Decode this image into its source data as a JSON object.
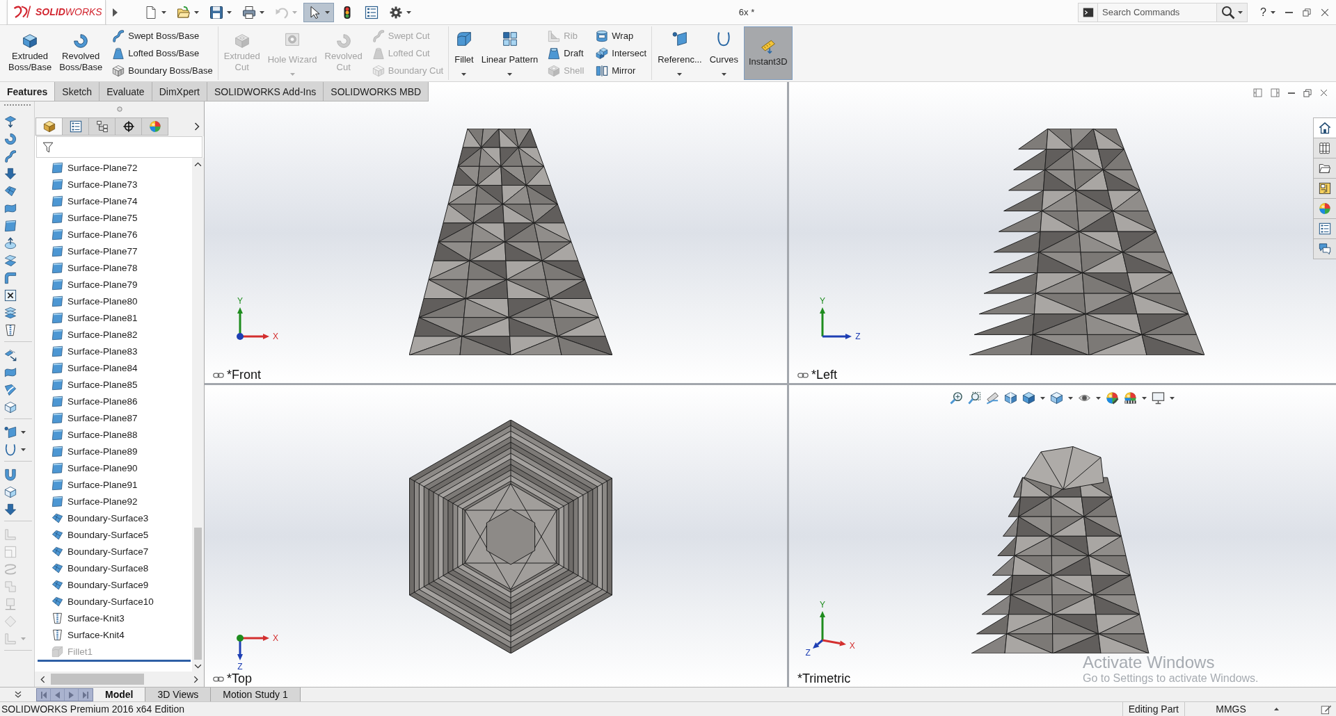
{
  "title_bar": {
    "logo": "**SOLID**WORKS",
    "document_title": "6x *",
    "search": {
      "placeholder": "Search Commands"
    },
    "help": "?"
  },
  "quick_access": [
    {
      "dropdown": true,
      "disabled": false,
      "selected": false
    },
    {
      "dropdown": true,
      "disabled": false,
      "selected": false
    },
    {
      "dropdown": true,
      "disabled": false,
      "selected": false
    },
    {
      "dropdown": true,
      "disabled": false,
      "selected": false
    },
    {
      "dropdown": true,
      "disabled": true,
      "selected": false
    },
    {
      "dropdown": true,
      "disabled": false,
      "selected": true
    },
    {
      "dropdown": false,
      "disabled": false,
      "selected": false
    },
    {
      "dropdown": false,
      "disabled": false,
      "selected": false
    },
    {
      "dropdown": true,
      "disabled": false,
      "selected": false
    }
  ],
  "ribbon": {
    "groups": [
      {
        "items": [
          {
            "kind": "large",
            "label": "Extruded Boss/Base",
            "disabled": false,
            "dropdown": false,
            "selected": false
          },
          {
            "kind": "large",
            "label": "Revolved Boss/Base",
            "disabled": false,
            "dropdown": false,
            "selected": false
          },
          {
            "kind": "stack",
            "tools": [
              {
                "label": "Swept Boss/Base",
                "disabled": false
              },
              {
                "label": "Lofted Boss/Base",
                "disabled": false
              },
              {
                "label": "Boundary Boss/Base",
                "disabled": false
              }
            ]
          }
        ]
      },
      {
        "items": [
          {
            "kind": "large",
            "label": "Extruded Cut",
            "disabled": true,
            "dropdown": false,
            "selected": false
          },
          {
            "kind": "large",
            "label": "Hole Wizard",
            "disabled": true,
            "dropdown": true,
            "selected": false
          },
          {
            "kind": "large",
            "label": "Revolved Cut",
            "disabled": true,
            "dropdown": false,
            "selected": false
          },
          {
            "kind": "stack",
            "tools": [
              {
                "label": "Swept Cut",
                "disabled": true
              },
              {
                "label": "Lofted Cut",
                "disabled": true
              },
              {
                "label": "Boundary Cut",
                "disabled": true
              }
            ]
          }
        ]
      },
      {
        "items": [
          {
            "kind": "large",
            "label": "Fillet",
            "disabled": false,
            "dropdown": true,
            "selected": false
          },
          {
            "kind": "large",
            "label": "Linear Pattern",
            "disabled": false,
            "dropdown": true,
            "selected": false
          },
          {
            "kind": "stack",
            "tools": [
              {
                "label": "Rib",
                "disabled": true
              },
              {
                "label": "Draft",
                "disabled": false
              },
              {
                "label": "Shell",
                "disabled": true
              }
            ]
          },
          {
            "kind": "stack",
            "tools": [
              {
                "label": "Wrap",
                "disabled": false
              },
              {
                "label": "Intersect",
                "disabled": false
              },
              {
                "label": "Mirror",
                "disabled": false
              }
            ]
          }
        ]
      },
      {
        "items": [
          {
            "kind": "large",
            "label": "Referenc...",
            "disabled": false,
            "dropdown": true,
            "selected": false
          },
          {
            "kind": "large",
            "label": "Curves",
            "disabled": false,
            "dropdown": true,
            "selected": false
          },
          {
            "kind": "large",
            "label": "Instant3D",
            "disabled": false,
            "dropdown": false,
            "selected": true
          }
        ]
      }
    ]
  },
  "command_tabs": [
    {
      "label": "Features",
      "selected": true
    },
    {
      "label": "Sketch",
      "selected": false
    },
    {
      "label": "Evaluate",
      "selected": false
    },
    {
      "label": "DimXpert",
      "selected": false
    },
    {
      "label": "SOLIDWORKS Add-Ins",
      "selected": false
    },
    {
      "label": "SOLIDWORKS MBD",
      "selected": false
    }
  ],
  "side_toolbar": {
    "groups": [
      {
        "tools": [
          {
            "disabled": false,
            "dropdown": false
          },
          {
            "disabled": false,
            "dropdown": false
          },
          {
            "disabled": false,
            "dropdown": false
          },
          {
            "disabled": false,
            "dropdown": false
          },
          {
            "disabled": false,
            "dropdown": false
          },
          {
            "disabled": false,
            "dropdown": false
          },
          {
            "disabled": false,
            "dropdown": false
          },
          {
            "disabled": false,
            "dropdown": false
          },
          {
            "disabled": false,
            "dropdown": false
          },
          {
            "disabled": false,
            "dropdown": false
          },
          {
            "disabled": false,
            "dropdown": false
          },
          {
            "disabled": false,
            "dropdown": false
          },
          {
            "disabled": false,
            "dropdown": false
          }
        ]
      },
      {
        "tools": [
          {
            "disabled": false,
            "dropdown": false
          },
          {
            "disabled": false,
            "dropdown": false
          },
          {
            "disabled": false,
            "dropdown": false
          },
          {
            "disabled": false,
            "dropdown": false
          }
        ]
      },
      {
        "tools": [
          {
            "disabled": false,
            "dropdown": true
          },
          {
            "disabled": false,
            "dropdown": true
          }
        ]
      },
      {
        "tools": [
          {
            "disabled": false,
            "dropdown": false
          },
          {
            "disabled": false,
            "dropdown": false
          },
          {
            "disabled": false,
            "dropdown": false
          }
        ]
      },
      {
        "tools": [
          {
            "disabled": true,
            "dropdown": false
          },
          {
            "disabled": true,
            "dropdown": false
          },
          {
            "disabled": true,
            "dropdown": false
          },
          {
            "disabled": true,
            "dropdown": false
          },
          {
            "disabled": true,
            "dropdown": false
          },
          {
            "disabled": true,
            "dropdown": false
          },
          {
            "disabled": true,
            "dropdown": true
          }
        ]
      }
    ]
  },
  "feature_tree": {
    "tabs": [
      {
        "selected": true
      },
      {
        "selected": false
      },
      {
        "selected": false
      },
      {
        "selected": false
      },
      {
        "selected": false
      }
    ],
    "items": [
      {
        "kind": "surface-plane",
        "label": "Surface-Plane72",
        "suppressed": false
      },
      {
        "kind": "surface-plane",
        "label": "Surface-Plane73",
        "suppressed": false
      },
      {
        "kind": "surface-plane",
        "label": "Surface-Plane74",
        "suppressed": false
      },
      {
        "kind": "surface-plane",
        "label": "Surface-Plane75",
        "suppressed": false
      },
      {
        "kind": "surface-plane",
        "label": "Surface-Plane76",
        "suppressed": false
      },
      {
        "kind": "surface-plane",
        "label": "Surface-Plane77",
        "suppressed": false
      },
      {
        "kind": "surface-plane",
        "label": "Surface-Plane78",
        "suppressed": false
      },
      {
        "kind": "surface-plane",
        "label": "Surface-Plane79",
        "suppressed": false
      },
      {
        "kind": "surface-plane",
        "label": "Surface-Plane80",
        "suppressed": false
      },
      {
        "kind": "surface-plane",
        "label": "Surface-Plane81",
        "suppressed": false
      },
      {
        "kind": "surface-plane",
        "label": "Surface-Plane82",
        "suppressed": false
      },
      {
        "kind": "surface-plane",
        "label": "Surface-Plane83",
        "suppressed": false
      },
      {
        "kind": "surface-plane",
        "label": "Surface-Plane84",
        "suppressed": false
      },
      {
        "kind": "surface-plane",
        "label": "Surface-Plane85",
        "suppressed": false
      },
      {
        "kind": "surface-plane",
        "label": "Surface-Plane86",
        "suppressed": false
      },
      {
        "kind": "surface-plane",
        "label": "Surface-Plane87",
        "suppressed": false
      },
      {
        "kind": "surface-plane",
        "label": "Surface-Plane88",
        "suppressed": false
      },
      {
        "kind": "surface-plane",
        "label": "Surface-Plane89",
        "suppressed": false
      },
      {
        "kind": "surface-plane",
        "label": "Surface-Plane90",
        "suppressed": false
      },
      {
        "kind": "surface-plane",
        "label": "Surface-Plane91",
        "suppressed": false
      },
      {
        "kind": "surface-plane",
        "label": "Surface-Plane92",
        "suppressed": false
      },
      {
        "kind": "boundary-surface",
        "label": "Boundary-Surface3",
        "suppressed": false
      },
      {
        "kind": "boundary-surface",
        "label": "Boundary-Surface5",
        "suppressed": false
      },
      {
        "kind": "boundary-surface",
        "label": "Boundary-Surface7",
        "suppressed": false
      },
      {
        "kind": "boundary-surface",
        "label": "Boundary-Surface8",
        "suppressed": false
      },
      {
        "kind": "boundary-surface",
        "label": "Boundary-Surface9",
        "suppressed": false
      },
      {
        "kind": "boundary-surface",
        "label": "Boundary-Surface10",
        "suppressed": false
      },
      {
        "kind": "knit",
        "label": "Surface-Knit3",
        "suppressed": false
      },
      {
        "kind": "knit",
        "label": "Surface-Knit4",
        "suppressed": false
      },
      {
        "kind": "fillet",
        "label": "Fillet1",
        "suppressed": true
      }
    ]
  },
  "viewports": [
    {
      "view_label": "*Front",
      "linked": true,
      "triad": [
        {
          "kind": "arrow",
          "label": "Y",
          "color": "#1e8c1e"
        },
        {
          "kind": "arrow",
          "label": "X",
          "color": "#d32f2f"
        },
        {
          "kind": "dot",
          "color": "#1e3fb4"
        }
      ]
    },
    {
      "view_label": "*Left",
      "linked": true,
      "triad": [
        {
          "kind": "arrow",
          "label": "Y",
          "color": "#1e8c1e"
        },
        {
          "kind": "arrow",
          "label": "Z",
          "color": "#1e3fb4"
        }
      ]
    },
    {
      "view_label": "*Top",
      "linked": true,
      "triad": [
        {
          "kind": "arrow",
          "label": "X",
          "color": "#d32f2f"
        },
        {
          "kind": "arrow",
          "label": "Z",
          "color": "#1e3fb4"
        },
        {
          "kind": "dot",
          "color": "#1e8c1e"
        }
      ]
    },
    {
      "view_label": "*Trimetric",
      "linked": false,
      "triad": [
        {
          "kind": "arrow",
          "label": "Y",
          "color": "#1e8c1e"
        },
        {
          "kind": "arrow",
          "label": "X",
          "color": "#d32f2f"
        },
        {
          "kind": "arrow",
          "label": "Z",
          "color": "#1e3fb4"
        }
      ]
    }
  ],
  "task_pane": [
    {
      "selected": true
    },
    {
      "selected": false
    },
    {
      "selected": false
    },
    {
      "selected": false
    },
    {
      "selected": false
    },
    {
      "selected": false
    },
    {
      "selected": false
    }
  ],
  "model_tabs": [
    {
      "label": "Model",
      "selected": true
    },
    {
      "label": "3D Views",
      "selected": false
    },
    {
      "label": "Motion Study 1",
      "selected": false
    }
  ],
  "status_bar": {
    "product": "SOLIDWORKS Premium 2016 x64 Edition",
    "mode": "Editing Part",
    "units": "MMGS"
  },
  "os_watermark": {
    "title": "Activate Windows",
    "subtitle": "Go to Settings to activate Windows."
  }
}
